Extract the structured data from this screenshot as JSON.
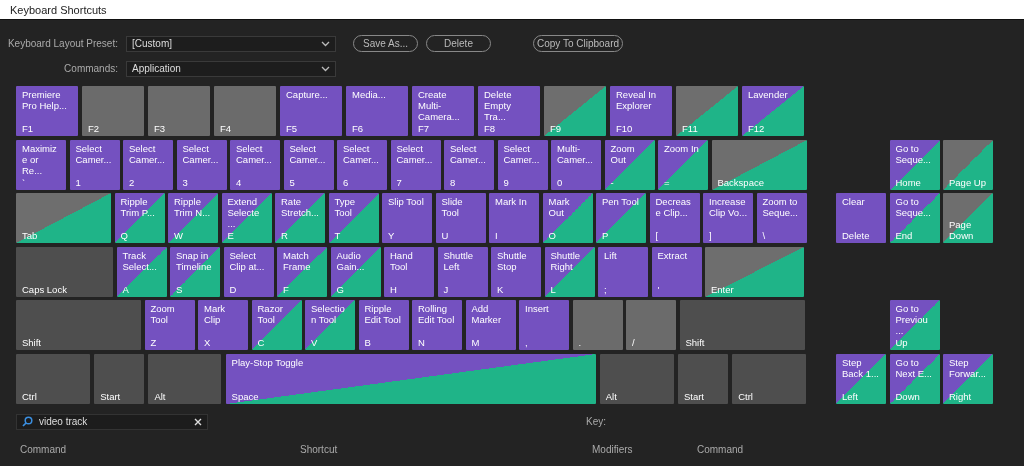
{
  "window": {
    "title": "Keyboard Shortcuts"
  },
  "preset": {
    "label": "Keyboard Layout Preset:",
    "value": "[Custom]"
  },
  "commands": {
    "label": "Commands:",
    "value": "Application"
  },
  "buttons": [
    "Save As...",
    "Delete"
  ],
  "copy_button": "Copy To Clipboard",
  "rows": [
    {
      "keys": [
        {
          "key": "F1",
          "command": "Premiere Pro Help...",
          "kind": "app"
        },
        {
          "key": "F2",
          "kind": "none"
        },
        {
          "key": "F3",
          "kind": "none"
        },
        {
          "key": "F4",
          "kind": "none"
        },
        {
          "key": "F5",
          "command": "Capture...",
          "kind": "app"
        },
        {
          "key": "F6",
          "command": "Media...",
          "kind": "app"
        },
        {
          "key": "F7",
          "command": "Create Multi-Camera...",
          "kind": "app"
        },
        {
          "key": "F8",
          "command": "Delete Empty Tra...",
          "kind": "app"
        },
        {
          "key": "F9",
          "kind": "panel"
        },
        {
          "key": "F10",
          "command": "Reveal In Explorer",
          "kind": "app"
        },
        {
          "key": "F11",
          "kind": "panel"
        },
        {
          "key": "F12",
          "command": "Lavender",
          "kind": "both"
        }
      ],
      "nav": []
    },
    {
      "keys": [
        {
          "key": "`",
          "command": "Maximize or Re...",
          "kind": "app"
        },
        {
          "key": "1",
          "command": "Select Camer...",
          "kind": "app"
        },
        {
          "key": "2",
          "command": "Select Camer...",
          "kind": "app"
        },
        {
          "key": "3",
          "command": "Select Camer...",
          "kind": "app"
        },
        {
          "key": "4",
          "command": "Select Camer...",
          "kind": "app"
        },
        {
          "key": "5",
          "command": "Select Camer...",
          "kind": "app"
        },
        {
          "key": "6",
          "command": "Select Camer...",
          "kind": "app"
        },
        {
          "key": "7",
          "command": "Select Camer...",
          "kind": "app"
        },
        {
          "key": "8",
          "command": "Select Camer...",
          "kind": "app"
        },
        {
          "key": "9",
          "command": "Select Camer...",
          "kind": "app"
        },
        {
          "key": "0",
          "command": "Multi-Camer...",
          "kind": "app"
        },
        {
          "key": "-",
          "command": "Zoom Out",
          "kind": "both"
        },
        {
          "key": "=",
          "command": "Zoom In",
          "kind": "both"
        },
        {
          "key": "Backspace",
          "kind": "panel"
        }
      ],
      "nav": [
        {
          "key": "Home",
          "command": "Go to Seque...",
          "kind": "both"
        },
        {
          "key": "Page Up",
          "kind": "panel"
        }
      ]
    },
    {
      "keys": [
        {
          "key": "Tab",
          "kind": "panel"
        },
        {
          "key": "Q",
          "command": "Ripple Trim P...",
          "kind": "both"
        },
        {
          "key": "W",
          "command": "Ripple Trim N...",
          "kind": "both"
        },
        {
          "key": "E",
          "command": "Extend Selecte ...",
          "kind": "both"
        },
        {
          "key": "R",
          "command": "Rate Stretch...",
          "kind": "both"
        },
        {
          "key": "T",
          "command": "Type Tool",
          "kind": "both"
        },
        {
          "key": "Y",
          "command": "Slip Tool",
          "kind": "app"
        },
        {
          "key": "U",
          "command": "Slide Tool",
          "kind": "app"
        },
        {
          "key": "I",
          "command": "Mark In",
          "kind": "app"
        },
        {
          "key": "O",
          "command": "Mark Out",
          "kind": "both"
        },
        {
          "key": "P",
          "command": "Pen Tool",
          "kind": "both"
        },
        {
          "key": "[",
          "command": "Decrease Clip...",
          "kind": "app"
        },
        {
          "key": "]",
          "command": "Increase Clip Vo...",
          "kind": "app"
        },
        {
          "key": "\\",
          "command": "Zoom to Seque...",
          "kind": "app"
        }
      ],
      "nav": [
        {
          "key": "Delete",
          "command": "Clear",
          "kind": "app"
        },
        {
          "key": "End",
          "command": "Go to Seque...",
          "kind": "both"
        },
        {
          "key": "Page Down",
          "kind": "panel"
        }
      ]
    },
    {
      "keys": [
        {
          "key": "Caps Lock",
          "kind": "modifier"
        },
        {
          "key": "A",
          "command": "Track Select...",
          "kind": "both"
        },
        {
          "key": "S",
          "command": "Snap in Timeline",
          "kind": "both"
        },
        {
          "key": "D",
          "command": "Select Clip at...",
          "kind": "app"
        },
        {
          "key": "F",
          "command": "Match Frame",
          "kind": "both"
        },
        {
          "key": "G",
          "command": "Audio Gain...",
          "kind": "both"
        },
        {
          "key": "H",
          "command": "Hand Tool",
          "kind": "app"
        },
        {
          "key": "J",
          "command": "Shuttle Left",
          "kind": "app"
        },
        {
          "key": "K",
          "command": "Shuttle Stop",
          "kind": "app"
        },
        {
          "key": "L",
          "command": "Shuttle Right",
          "kind": "both"
        },
        {
          "key": ";",
          "command": "Lift",
          "kind": "app"
        },
        {
          "key": "'",
          "command": "Extract",
          "kind": "app"
        },
        {
          "key": "Enter",
          "kind": "panel"
        }
      ],
      "nav": []
    },
    {
      "keys": [
        {
          "key": "Shift",
          "kind": "modifier"
        },
        {
          "key": "Z",
          "command": "Zoom Tool",
          "kind": "app"
        },
        {
          "key": "X",
          "command": "Mark Clip",
          "kind": "app"
        },
        {
          "key": "C",
          "command": "Razor Tool",
          "kind": "both"
        },
        {
          "key": "V",
          "command": "Selection Tool",
          "kind": "both"
        },
        {
          "key": "B",
          "command": "Ripple Edit Tool",
          "kind": "app"
        },
        {
          "key": "N",
          "command": "Rolling Edit Tool",
          "kind": "app"
        },
        {
          "key": "M",
          "command": "Add Marker",
          "kind": "app"
        },
        {
          "key": ",",
          "command": "Insert",
          "kind": "app"
        },
        {
          "key": ".",
          "kind": "none"
        },
        {
          "key": "/",
          "kind": "none"
        },
        {
          "key": "Shift",
          "kind": "modifier"
        }
      ],
      "nav": [
        {
          "key": "Up",
          "command": "Go to Previou ...",
          "kind": "both"
        }
      ]
    },
    {
      "keys": [
        {
          "key": "Ctrl",
          "kind": "modifier"
        },
        {
          "key": "Start",
          "kind": "modifier"
        },
        {
          "key": "Alt",
          "kind": "modifier"
        },
        {
          "key": "Space",
          "command": "Play-Stop Toggle",
          "kind": "both"
        },
        {
          "key": "Alt",
          "kind": "modifier"
        },
        {
          "key": "Start",
          "kind": "modifier"
        },
        {
          "key": "Ctrl",
          "kind": "modifier"
        }
      ],
      "nav": [
        {
          "key": "Left",
          "command": "Step Back 1...",
          "kind": "both"
        },
        {
          "key": "Down",
          "command": "Go to Next E...",
          "kind": "both"
        },
        {
          "key": "Right",
          "command": "Step Forwar...",
          "kind": "both"
        }
      ]
    }
  ],
  "search": {
    "value": "video track"
  },
  "key_label": "Key:",
  "table": {
    "columns": [
      "Command",
      "Shortcut"
    ]
  },
  "key_table": {
    "columns": [
      "Modifiers",
      "Command"
    ]
  }
}
